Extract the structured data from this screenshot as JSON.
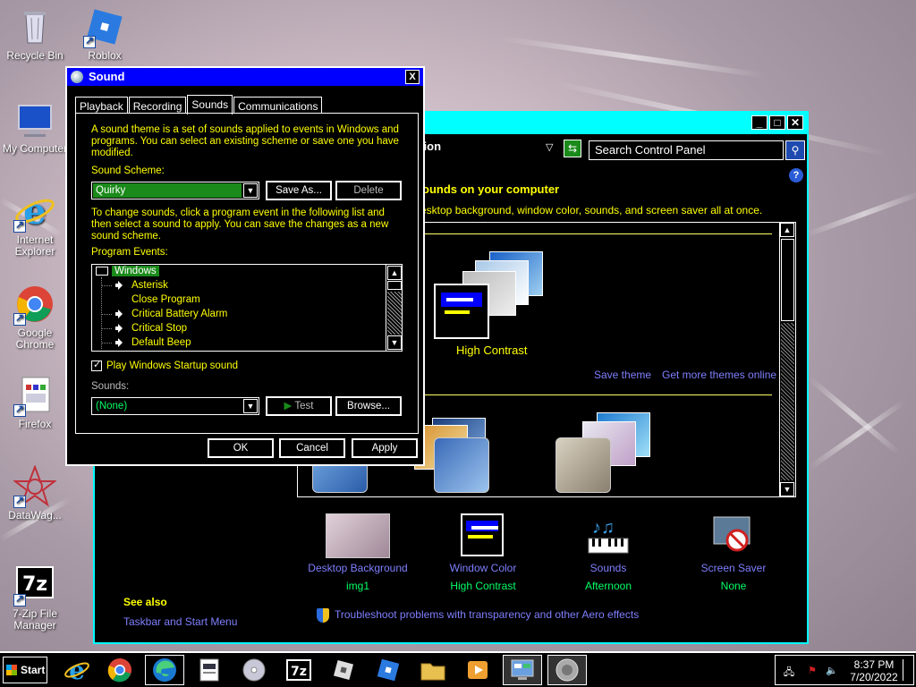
{
  "desktop": {
    "icons": [
      {
        "label": "Recycle Bin"
      },
      {
        "label": "Roblox"
      },
      {
        "label": "My Computer"
      },
      {
        "label": "Internet Explorer"
      },
      {
        "label": "Google Chrome"
      },
      {
        "label": "Firefox"
      },
      {
        "label": "DataWag..."
      },
      {
        "label": "7-Zip File Manager"
      }
    ]
  },
  "control_panel": {
    "address_text": "ation",
    "search_placeholder": "Search Control Panel",
    "help_label": "?",
    "heading": "ounds on your computer",
    "subheading": "esktop background, window color, sounds, and screen saver all at once.",
    "high_contrast_label": "High Contrast",
    "save_theme": "Save theme",
    "get_more_themes": "Get more themes online",
    "items": [
      {
        "title": "Desktop Background",
        "value": "img1"
      },
      {
        "title": "Window Color",
        "value": "High Contrast"
      },
      {
        "title": "Sounds",
        "value": "Afternoon"
      },
      {
        "title": "Screen Saver",
        "value": "None"
      }
    ],
    "see_also": "See also",
    "taskbar_link": "Taskbar and Start Menu",
    "troubleshoot_link": "Troubleshoot problems with transparency and other Aero effects"
  },
  "sound_dialog": {
    "title": "Sound",
    "close_label": "X",
    "tabs": [
      {
        "label": "Playback"
      },
      {
        "label": "Recording"
      },
      {
        "label": "Sounds"
      },
      {
        "label": "Communications"
      }
    ],
    "description": "A sound theme is a set of sounds applied to events in Windows and programs.  You can select an existing scheme or save one you have modified.",
    "scheme_label": "Sound Scheme:",
    "scheme_value": "Quirky",
    "save_as": "Save As...",
    "delete": "Delete",
    "instructions": "To change sounds, click a program event in the following list and then select a sound to apply.  You can save the changes as a new sound scheme.",
    "program_events_label": "Program Events:",
    "events": [
      {
        "label": "Windows"
      },
      {
        "label": "Asterisk"
      },
      {
        "label": "Close Program"
      },
      {
        "label": "Critical Battery Alarm"
      },
      {
        "label": "Critical Stop"
      },
      {
        "label": "Default Beep"
      }
    ],
    "startup_checkbox": "Play Windows Startup sound",
    "startup_checked": true,
    "sounds_label": "Sounds:",
    "sounds_value": "(None)",
    "test": "Test",
    "browse": "Browse...",
    "ok": "OK",
    "cancel": "Cancel",
    "apply": "Apply"
  },
  "taskbar": {
    "start_label": "Start",
    "time": "8:37 PM",
    "date": "7/20/2022"
  }
}
